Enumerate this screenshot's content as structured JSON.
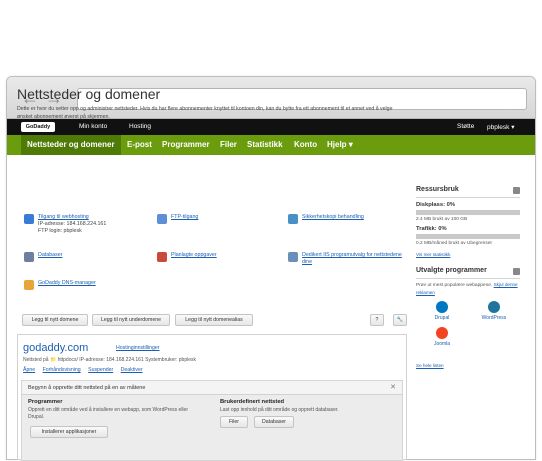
{
  "topbar": {
    "logo": "GoDaddy",
    "my_account": "Min konto",
    "hosting": "Hosting",
    "support": "Støtte",
    "user": "pbplesk ▾"
  },
  "nav": {
    "items": [
      "Nettsteder og domener",
      "E-post",
      "Programmer",
      "Filer",
      "Statistikk",
      "Konto",
      "Hjelp ▾"
    ]
  },
  "page": {
    "title": "Nettsteder og domener",
    "intro": "Dette er hvor du setter opp og administrer nettsteder. Hvis du har flere abonnementer knyttet til kontoen din, kan du bytte fra ett abonnement til et annet ved å velge ønsket abonnement øverst på skjermen."
  },
  "services": {
    "webhosting_link": "Tilgang til webhosting",
    "ip_line": "IP-adresse: 184.168.224.161",
    "ftp_login": "FTP login: pbplesk",
    "ftp_access": "FTP-tilgang",
    "backup": "Sikkerhetskopi behandling",
    "databases": "Databaser",
    "scheduled": "Planlagte oppgaver",
    "iis_pool": "Dedikert IIS programutvalg for nettstedene dine",
    "dns": "GoDaddy DNS-manager"
  },
  "toolbar": {
    "add_domain": "Legg til nytt domene",
    "add_subdomain": "Legg til nytt underdomene",
    "add_alias": "Legg til nytt domenealias",
    "help": "?",
    "tools": "🔧"
  },
  "domain": {
    "name": "godaddy.com",
    "hosting_settings": "Hostinginnstillinger",
    "meta": "Nettsted på 📁 httpdocs/   IP-adresse: 184.168.224.161   Systembruker: pbplesk",
    "actions": [
      "Åpne",
      "Forhåndsvisning",
      "Suspender",
      "Deaktiver"
    ]
  },
  "getting_started": {
    "header": "Begynn å opprette ditt nettsted på en av måtene",
    "close": "✕",
    "programs_title": "Programmer",
    "programs_text": "Opprett en ditt område ved å installere en webapp, som WordPress eller Drupal.",
    "install_button": "Installerer applikasjoner",
    "custom_title": "Brukerdefinert nettsted",
    "custom_text": "Last opp innhold på ditt område og opprett databaser.",
    "files_button": "Filer",
    "db_button": "Databaser"
  },
  "sidebar": {
    "resources_title": "Ressursbruk",
    "disk_label": "Diskplass: 0%",
    "disk_value": 0,
    "disk_sub": "2.4 MB brukt av 100 GB",
    "traffic_label": "Trafikk: 0%",
    "traffic_value": 0,
    "traffic_sub": "0.2 MB/måned brukt av Ubegrenset",
    "more_stats": "Vis mer statistikk",
    "programs_title": "Utvalgte programmer",
    "programs_desc": "Prøv ut mest populære webappene.",
    "programs_link": "Skjul denne reklamen",
    "apps": [
      "Drupal",
      "WordPress",
      "Joomla"
    ],
    "all_apps": "Se hele listen"
  },
  "colors": {
    "green": "#6b9c0d",
    "green_active": "#4e7a05",
    "link": "#1a5fb4"
  }
}
